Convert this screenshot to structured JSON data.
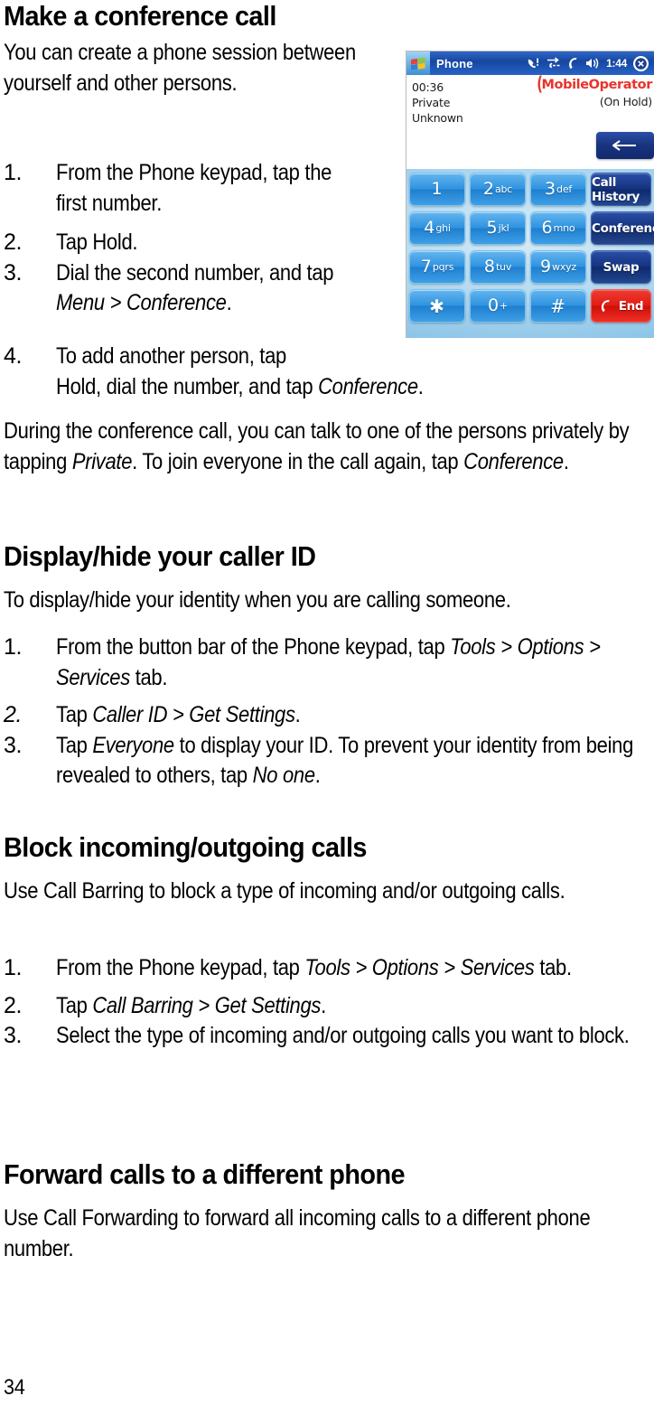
{
  "page": {
    "folio": "34"
  },
  "sections": [
    {
      "heading": "Make a conference call",
      "intro": "You can create a phone session between yourself and other persons.",
      "steps": [
        {
          "num": "1.",
          "parts": [
            {
              "t": "From the Phone keypad, tap the first number.",
              "i": false
            }
          ]
        },
        {
          "num": "2.",
          "parts": [
            {
              "t": "Tap Hold.",
              "i": false
            }
          ]
        },
        {
          "num": "3.",
          "parts": [
            {
              "t": "Dial the second number, and tap ",
              "i": false
            },
            {
              "t": "Menu > Conference",
              "i": true
            },
            {
              "t": ".",
              "i": false
            }
          ]
        },
        {
          "num": "4.",
          "parts": [
            {
              "t": "To add another person, tap Hold, dial the number, and tap ",
              "i": false
            },
            {
              "t": "Conference",
              "i": true
            },
            {
              "t": ".",
              "i": false
            }
          ]
        }
      ],
      "outro_parts": [
        {
          "t": "During the conference call, you can talk to one of the persons privately by tapping ",
          "i": false
        },
        {
          "t": "Private",
          "i": true
        },
        {
          "t": ". To join everyone in the call again, tap ",
          "i": false
        },
        {
          "t": "Conference",
          "i": true
        },
        {
          "t": ".",
          "i": false
        }
      ]
    },
    {
      "heading": "Display/hide your caller ID",
      "intro": "To display/hide your identity when you are calling someone.",
      "steps": [
        {
          "num": "1.",
          "parts": [
            {
              "t": "From the button bar of the Phone keypad, tap ",
              "i": false
            },
            {
              "t": "Tools > Options > Services",
              "i": true
            },
            {
              "t": " tab.",
              "i": false
            }
          ]
        },
        {
          "num": "2.",
          "num_italic": true,
          "parts": [
            {
              "t": "Tap ",
              "i": false
            },
            {
              "t": "Caller ID > Get Settings",
              "i": true
            },
            {
              "t": ".",
              "i": false
            }
          ]
        },
        {
          "num": "3.",
          "parts": [
            {
              "t": "Tap ",
              "i": false
            },
            {
              "t": "Everyone",
              "i": true
            },
            {
              "t": " to display your ID. To prevent your identity from being revealed to others, tap ",
              "i": false
            },
            {
              "t": "No one",
              "i": true
            },
            {
              "t": ".",
              "i": false
            }
          ]
        }
      ]
    },
    {
      "heading": "Block incoming/outgoing calls",
      "intro": "Use Call Barring to block a type of incoming and/or outgoing calls.",
      "steps": [
        {
          "num": "1.",
          "parts": [
            {
              "t": "From the Phone keypad, tap ",
              "i": false
            },
            {
              "t": "Tools > Options > Services",
              "i": true
            },
            {
              "t": " tab.",
              "i": false
            }
          ]
        },
        {
          "num": "2.",
          "parts": [
            {
              "t": "Tap ",
              "i": false
            },
            {
              "t": "Call Barring > Get Settings",
              "i": true
            },
            {
              "t": ".",
              "i": false
            }
          ]
        },
        {
          "num": "3.",
          "parts": [
            {
              "t": "Select the type of incoming and/or outgoing calls you want to block.",
              "i": false
            }
          ]
        }
      ]
    },
    {
      "heading": "Forward calls to a different phone",
      "intro": "Use Call Forwarding to forward all incoming calls to a different phone number.",
      "steps": []
    }
  ],
  "device": {
    "titlebar": {
      "app_title": "Phone",
      "clock": "1:44",
      "icons": [
        "windows-logo-icon",
        "missed-call-icon",
        "data-connection-icon",
        "active-call-icon",
        "speaker-icon",
        "close-icon"
      ]
    },
    "call_info": {
      "duration": "00:36",
      "line1": "Private",
      "line2": "Unknown",
      "status": "(On Hold)",
      "operator": "MobileOperator",
      "operator_color": "#e8342b"
    },
    "back_button": "back-arrow-icon",
    "keypad": {
      "rows": [
        [
          {
            "digit": "1",
            "sub": ""
          },
          {
            "digit": "2",
            "sub": "abc"
          },
          {
            "digit": "3",
            "sub": "def"
          }
        ],
        [
          {
            "digit": "4",
            "sub": "ghi"
          },
          {
            "digit": "5",
            "sub": "jkl"
          },
          {
            "digit": "6",
            "sub": "mno"
          }
        ],
        [
          {
            "digit": "7",
            "sub": "pqrs"
          },
          {
            "digit": "8",
            "sub": "tuv"
          },
          {
            "digit": "9",
            "sub": "wxyz"
          }
        ],
        [
          {
            "digit": "✱",
            "sub": ""
          },
          {
            "digit": "0",
            "sub": "+"
          },
          {
            "digit": "#",
            "sub": ""
          }
        ]
      ],
      "actions": [
        "Call History",
        "Conference",
        "Swap",
        "End"
      ],
      "end_label": "End",
      "key_color": "#2f93e0",
      "action_color": "#15337f",
      "end_color": "#e01d14"
    }
  }
}
